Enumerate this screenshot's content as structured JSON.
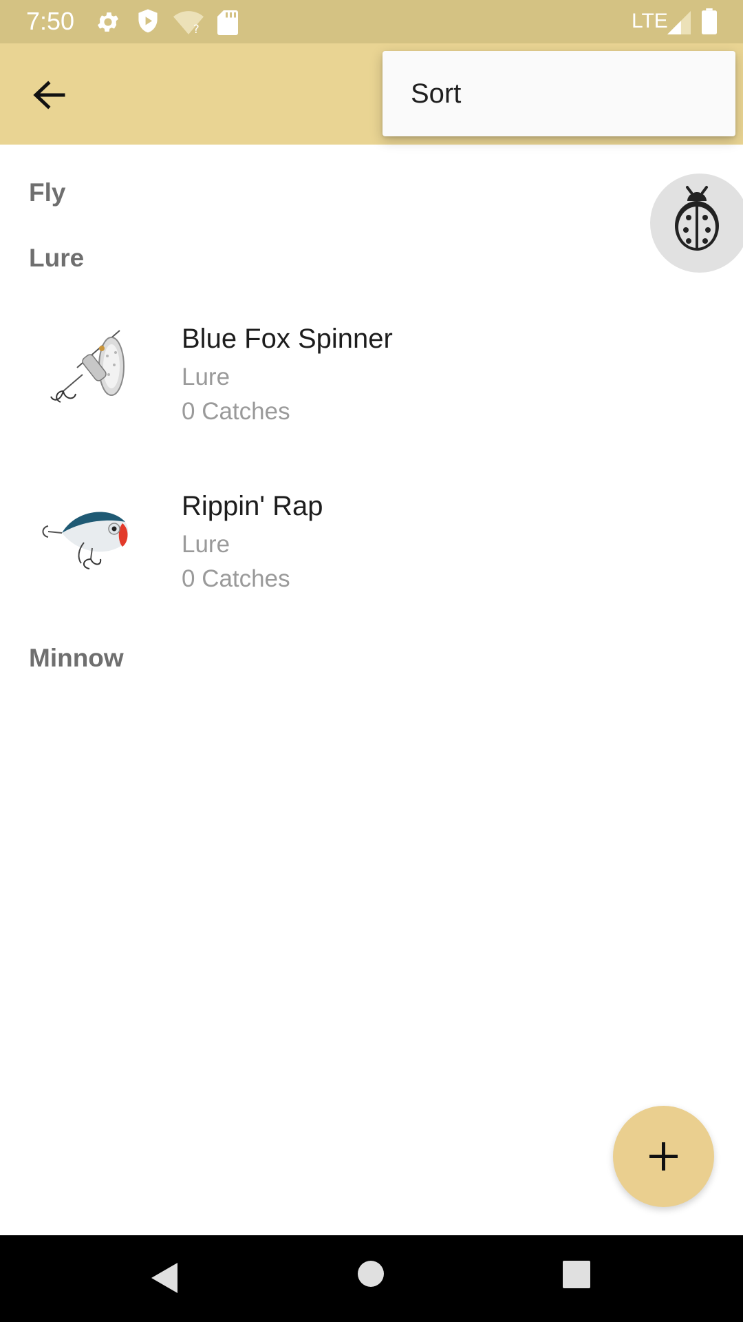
{
  "status_bar": {
    "time": "7:50",
    "network": "LTE",
    "icons": [
      "gear-icon",
      "shield-icon",
      "wifi-unknown-icon",
      "sd-card-icon",
      "signal-icon",
      "battery-icon"
    ]
  },
  "app_bar": {
    "back_icon": "arrow-left-icon"
  },
  "menu": {
    "items": [
      {
        "label": "Sort"
      }
    ]
  },
  "sections": [
    {
      "title": "Fly",
      "items": []
    },
    {
      "title": "Lure",
      "items": [
        {
          "name": "Blue Fox Spinner",
          "type": "Lure",
          "catches": "0 Catches",
          "image": "spinner-lure-image"
        },
        {
          "name": "Rippin' Rap",
          "type": "Lure",
          "catches": "0 Catches",
          "image": "crankbait-lure-image"
        }
      ]
    },
    {
      "title": "Minnow",
      "items": []
    }
  ],
  "floating_buttons": {
    "debug_icon": "ladybug-icon",
    "add_icon": "plus-icon"
  },
  "colors": {
    "status_bar": "#d4c283",
    "app_bar": "#e9d493",
    "fab": "#eacf8f"
  },
  "nav_bar": {
    "icons": [
      "back-triangle-icon",
      "home-circle-icon",
      "recents-square-icon"
    ]
  }
}
